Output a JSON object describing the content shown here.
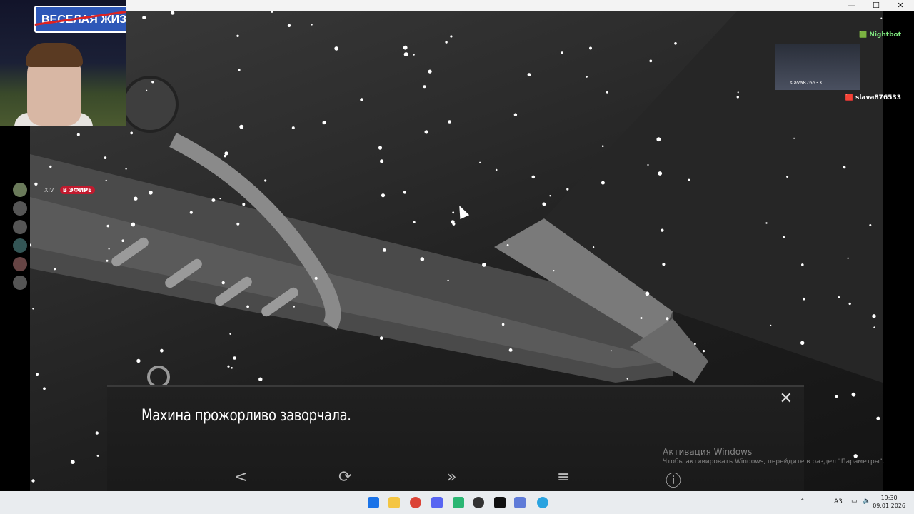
{
  "window": {
    "minimize": "—",
    "maximize": "☐",
    "close": "✕"
  },
  "webcam": {
    "sign_text": "ВЕСЕЛАЯ ЖИЗ"
  },
  "stream": {
    "live_badge": "В ЭФИРЕ",
    "viewers": "XIV"
  },
  "chat": {
    "messages": [
      {
        "user": "Nightbot"
      },
      {
        "user": "slava876533"
      }
    ],
    "thumb_user": "slava876533"
  },
  "dialog": {
    "text": "Махина прожорливо заворчала.",
    "close": "✕",
    "controls": {
      "back": "<",
      "auto": "⟳",
      "skip": "»",
      "menu": "≡",
      "info": "ⓘ"
    }
  },
  "watermark": {
    "title": "Активация Windows",
    "subtitle": "Чтобы активировать Windows, перейдите в раздел \"Параметры\"."
  },
  "taskbar": {
    "icons": [
      "windows-icon",
      "explorer-icon",
      "chrome-icon",
      "discord-icon",
      "app-icon",
      "obs-icon",
      "terminal-icon",
      "bot-icon",
      "telegram-icon"
    ],
    "tray_lang": "A3",
    "time": "19:30",
    "date": "09.01.2026"
  },
  "colors": {
    "live": "#c21a2e",
    "taskbar": "#e9ecef"
  }
}
